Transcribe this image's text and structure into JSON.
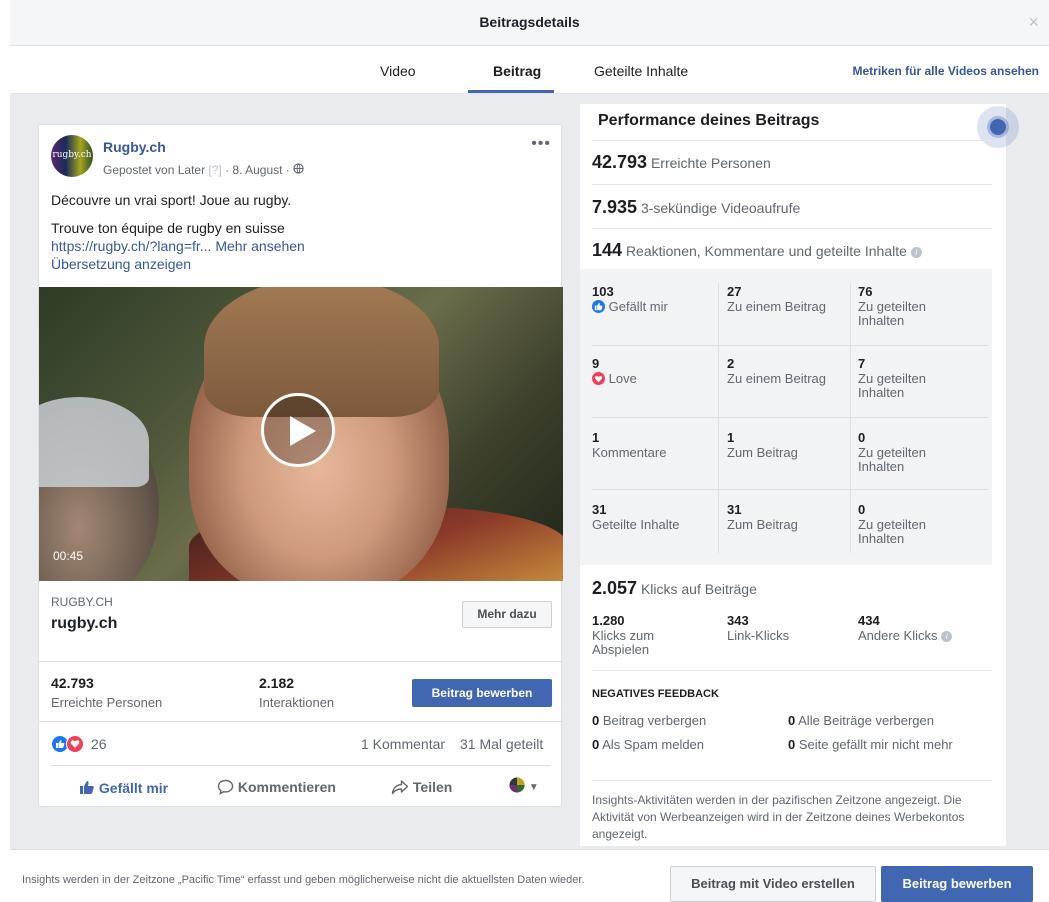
{
  "dialog": {
    "title": "Beitragsdetails",
    "close": "×"
  },
  "tabs": {
    "items": [
      {
        "label": "Video"
      },
      {
        "label": "Beitrag"
      },
      {
        "label": "Geteilte Inhalte"
      }
    ],
    "link": "Metriken für alle Videos ansehen"
  },
  "post": {
    "avatar_text": "rugby.ch",
    "page_name": "Rugby.ch",
    "meta_prefix": "Gepostet von ",
    "meta_app": "Later",
    "meta_q": "[?]",
    "meta_date": " · 8. August · ",
    "line1": "Découvre un vrai sport! Joue au rugby.",
    "line2": "Trouve ton équipe de rugby en suisse",
    "link_url": "https://rugby.ch/?lang=fr...",
    "see_more": "Mehr ansehen",
    "translate": "Übersetzung anzeigen",
    "video_duration": "00:45",
    "link_domain": "RUGBY.CH",
    "link_title": "rugby.ch",
    "more_button": "Mehr dazu",
    "reach_value": "42.793",
    "reach_label": "Erreichte Personen",
    "interactions_value": "2.182",
    "interactions_label": "Interaktionen",
    "boost_button": "Beitrag bewerben",
    "reaction_count": "26",
    "comments": "1 Kommentar",
    "shares": "31 Mal geteilt",
    "actions": {
      "like": "Gefällt mir",
      "comment": "Kommentieren",
      "share": "Teilen"
    }
  },
  "performance": {
    "title": "Performance deines Beitrags",
    "reach": {
      "value": "42.793",
      "label": "Erreichte Personen"
    },
    "views": {
      "value": "7.935",
      "label": "3-sekündige Videoaufrufe"
    },
    "reactions": {
      "value": "144",
      "label": "Reaktionen, Kommentare und geteilte Inhalte"
    },
    "grid": [
      [
        {
          "n": "103",
          "label": "Gefällt mir",
          "icon": "like"
        },
        {
          "n": "27",
          "label": "Zu einem Beitrag"
        },
        {
          "n": "76",
          "label": "Zu geteilten Inhalten"
        }
      ],
      [
        {
          "n": "9",
          "label": "Love",
          "icon": "love"
        },
        {
          "n": "2",
          "label": "Zu einem Beitrag"
        },
        {
          "n": "7",
          "label": "Zu geteilten Inhalten"
        }
      ],
      [
        {
          "n": "1",
          "label": "Kommentare"
        },
        {
          "n": "1",
          "label": "Zum Beitrag"
        },
        {
          "n": "0",
          "label": "Zu geteilten Inhalten"
        }
      ],
      [
        {
          "n": "31",
          "label": "Geteilte Inhalte"
        },
        {
          "n": "31",
          "label": "Zum Beitrag"
        },
        {
          "n": "0",
          "label": "Zu geteilten Inhalten"
        }
      ]
    ],
    "clicks": {
      "value": "2.057",
      "label": "Klicks auf Beiträge"
    },
    "click_breakdown": [
      {
        "n": "1.280",
        "label": "Klicks zum Abspielen"
      },
      {
        "n": "343",
        "label": "Link-Klicks"
      },
      {
        "n": "434",
        "label": "Andere Klicks"
      }
    ],
    "negative": {
      "title": "NEGATIVES FEEDBACK",
      "items": [
        {
          "n": "0",
          "label": "Beitrag verbergen"
        },
        {
          "n": "0",
          "label": "Alle Beiträge verbergen"
        },
        {
          "n": "0",
          "label": "Als Spam melden"
        },
        {
          "n": "0",
          "label": "Seite gefällt mir nicht mehr"
        }
      ]
    },
    "note": "Insights-Aktivitäten werden in der pazifischen Zeitzone angezeigt. Die Aktivität von Werbeanzeigen wird in der Zeitzone deines Werbekontos angezeigt."
  },
  "footer": {
    "text": "Insights werden in der Zeitzone „Pacific Time“ erfasst und geben möglicherweise nicht die aktuellsten Daten wieder.",
    "create_button": "Beitrag mit Video erstellen",
    "boost_button": "Beitrag bewerben"
  },
  "colors": {
    "brand": "#4267b2",
    "link": "#365899",
    "love": "#f33e58",
    "like": "#1877f2"
  }
}
